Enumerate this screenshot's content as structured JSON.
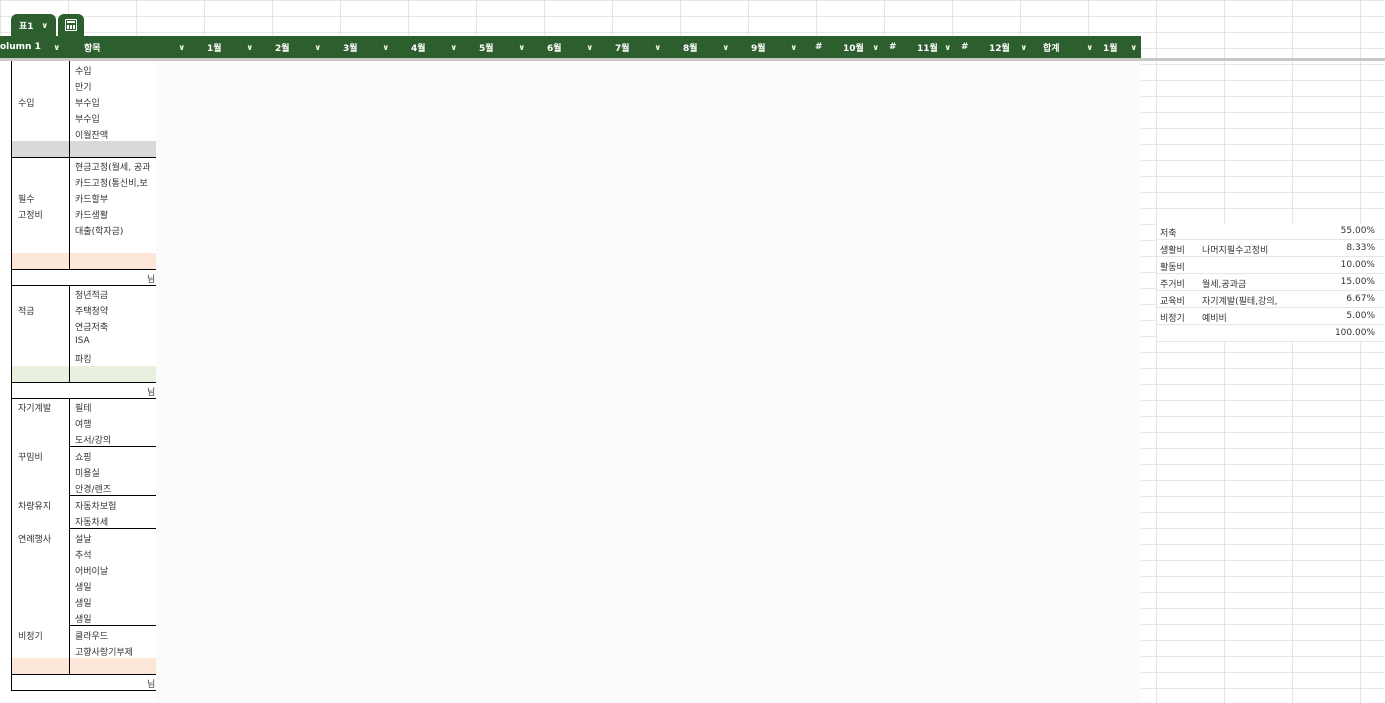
{
  "tabs": [
    {
      "label": "표1"
    }
  ],
  "header": {
    "columns": [
      "olumn 1",
      "항목",
      "1월",
      "2월",
      "3월",
      "4월",
      "5월",
      "6월",
      "7월",
      "8월",
      "9월",
      "#",
      "10월",
      "#",
      "11월",
      "#",
      "12월",
      "합계",
      "1월"
    ]
  },
  "sections": {
    "income": {
      "category": "수입",
      "items": [
        "수입",
        "만기",
        "부수입",
        "부수입",
        "이월잔액"
      ]
    },
    "fixed": {
      "category_line1": "필수",
      "category_line2": "고정비",
      "items": [
        "현금고정(월세, 공과",
        "카드고정(통신비,보",
        "카드할부",
        "카드생활",
        "대출(학자금)"
      ]
    },
    "savings": {
      "category": "적금",
      "items": [
        "청년적금",
        "주택청약",
        "연금저축",
        "ISA",
        "파킹"
      ]
    },
    "self_dev": {
      "category": "자기계발",
      "items": [
        "필테",
        "여행",
        "도서/강의"
      ]
    },
    "beauty": {
      "category": "꾸밈비",
      "items": [
        "쇼핑",
        "미용실",
        "안경/렌즈"
      ]
    },
    "car": {
      "category": "차량유지",
      "items": [
        "자동차보험",
        "자동차세"
      ]
    },
    "events": {
      "category": "연례행사",
      "items": [
        "설날",
        "추석",
        "어버이날",
        "생일",
        "생일",
        "생일"
      ]
    },
    "irregular": {
      "category": "비정기",
      "items": [
        "클라우드",
        "고향사랑기부제"
      ]
    },
    "truncated_marker": "님"
  },
  "ratios": [
    {
      "key": "저축",
      "desc": "",
      "pct": "55.00%"
    },
    {
      "key": "생활비",
      "desc": "나머지필수고정비",
      "pct": "8.33%"
    },
    {
      "key": "활동비",
      "desc": "",
      "pct": "10.00%"
    },
    {
      "key": "주거비",
      "desc": "월세,공과금",
      "pct": "15.00%"
    },
    {
      "key": "교육비",
      "desc": "자기계발(필테,강의,도서",
      "pct": "6.67%"
    },
    {
      "key": "비정기",
      "desc": "예비비",
      "pct": "5.00%"
    },
    {
      "key": "",
      "desc": "",
      "pct": "100.00%"
    }
  ],
  "colors": {
    "header_green": "#2d5e2e",
    "gray_band": "#d9d9d9",
    "peach_band": "#fde7d9",
    "green_band": "#e8f0e0"
  }
}
